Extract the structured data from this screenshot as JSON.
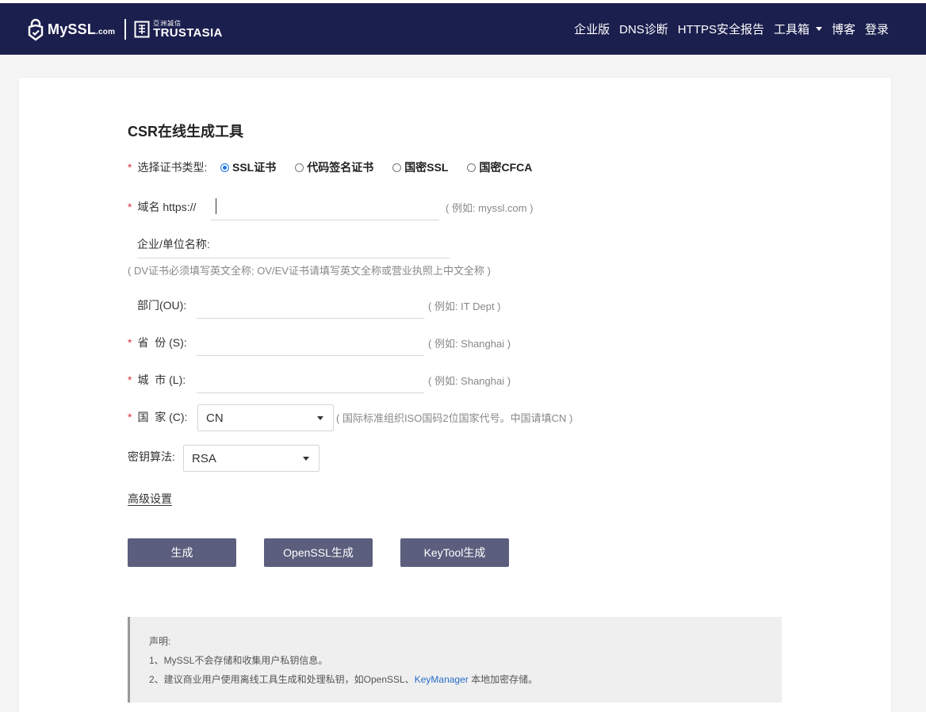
{
  "header": {
    "brand_main": "MySSL",
    "brand_suffix": ".com",
    "partner_cn": "亞洲誠信",
    "partner_en": "TRUSTASIA",
    "nav": [
      "企业版",
      "DNS诊断",
      "HTTPS安全报告",
      "工具箱",
      "博客",
      "登录"
    ]
  },
  "form": {
    "title": "CSR在线生成工具",
    "required_mark": "*",
    "cert_type_label": "选择证书类型:",
    "cert_types": [
      "SSL证书",
      "代码签名证书",
      "国密SSL",
      "国密CFCA"
    ],
    "cert_type_selected": "SSL证书",
    "domain_label": "域名 https://",
    "domain_value": "",
    "domain_hint": "( 例如: myssl.com )",
    "org_label": "企业/单位名称:",
    "org_hint": "( DV证书必须填写英文全称; OV/EV证书请填写英文全称或营业执照上中文全称 )",
    "ou_label": "部门(OU):",
    "ou_hint": "( 例如: IT Dept )",
    "province_label": "省  份 (S):",
    "province_hint": "( 例如: Shanghai )",
    "city_label": "城  市 (L):",
    "city_hint": "( 例如: Shanghai )",
    "country_label": "国  家 (C):",
    "country_value": "CN",
    "country_hint": "( 国际标准组织ISO国码2位国家代号。中国请填CN )",
    "algo_label": "密钥算法:",
    "algo_value": "RSA",
    "advanced_link": "高级设置",
    "buttons": [
      "生成",
      "OpenSSL生成",
      "KeyTool生成"
    ]
  },
  "notice": {
    "heading": "声明:",
    "line1": "1、MySSL不会存储和收集用户私钥信息。",
    "line2_prefix": "2、建议商业用户使用离线工具生成和处理私钥，如OpenSSL、",
    "line2_link": "KeyManager",
    "line2_suffix": " 本地加密存储。"
  },
  "colors": {
    "header_bg": "#1b1f4e",
    "button_bg": "#5b5e7d",
    "required": "#e0343f",
    "link": "#2a6ec7"
  }
}
